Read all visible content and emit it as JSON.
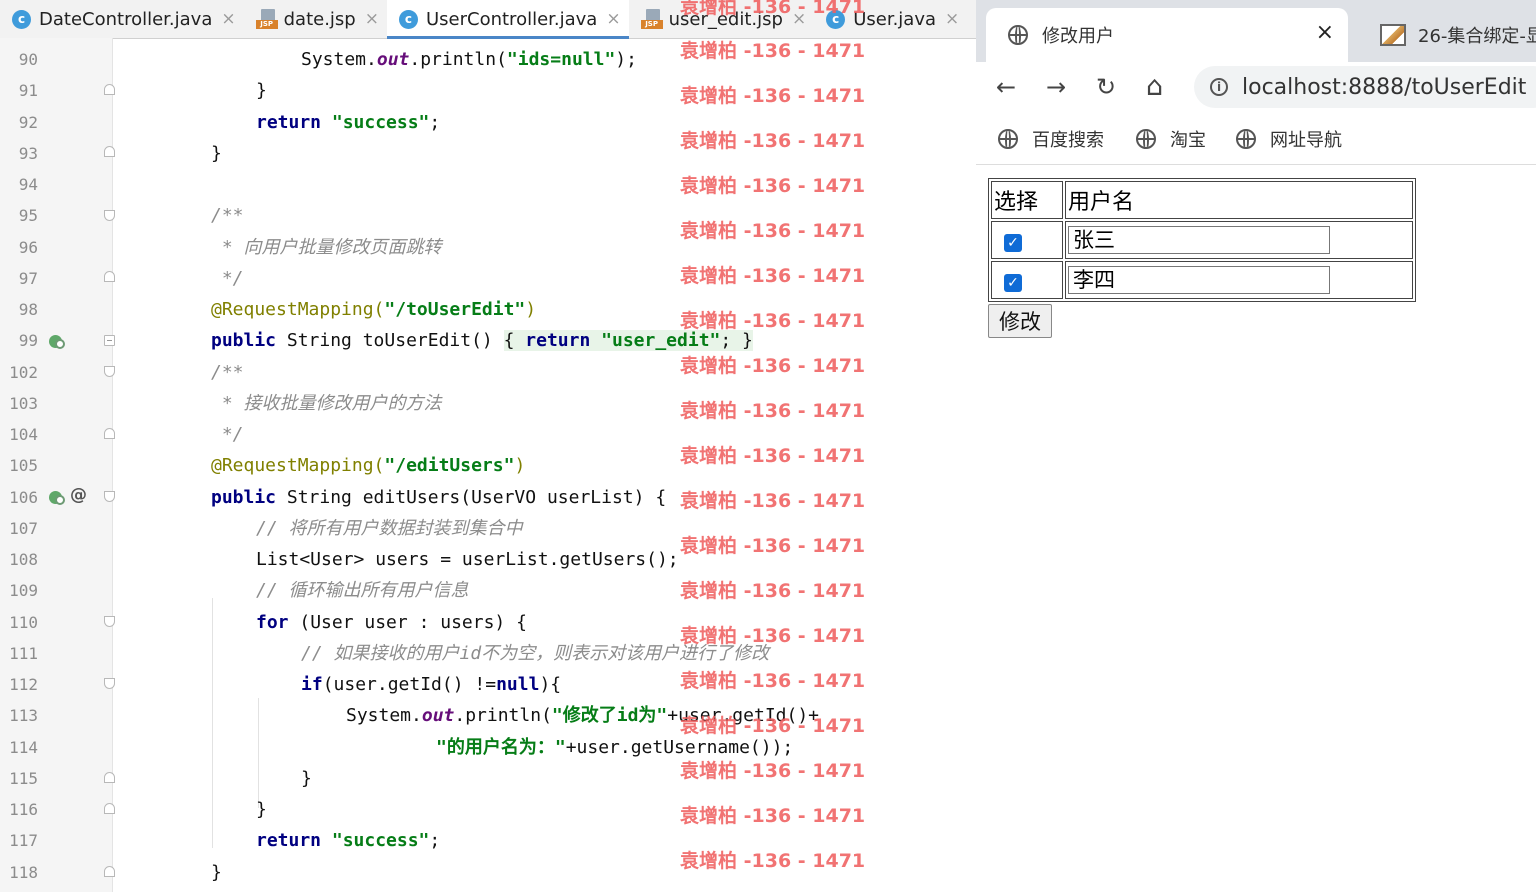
{
  "ide": {
    "tabs": [
      {
        "label": "DateController.java",
        "icon": "java-class-icon"
      },
      {
        "label": "date.jsp",
        "icon": "jsp-file-icon"
      },
      {
        "label": "UserController.java",
        "icon": "java-class-icon",
        "active": true
      },
      {
        "label": "user_edit.jsp",
        "icon": "jsp-file-icon"
      },
      {
        "label": "User.java",
        "icon": "java-class-icon"
      }
    ],
    "close_glyph": "×",
    "line_numbers": [
      "90",
      "91",
      "92",
      "93",
      "94",
      "95",
      "96",
      "97",
      "98",
      "99",
      "102",
      "103",
      "104",
      "105",
      "106",
      "107",
      "108",
      "109",
      "110",
      "111",
      "112",
      "113",
      "114",
      "115",
      "116",
      "117",
      "118"
    ],
    "code": [
      {
        "indent": 3,
        "tokens": [
          [
            "",
            "System."
          ],
          [
            "fld",
            "out"
          ],
          [
            "",
            ".println("
          ],
          [
            "str",
            "\"ids=null\""
          ],
          [
            "",
            ");"
          ]
        ]
      },
      {
        "indent": 2,
        "tokens": [
          [
            "",
            "}"
          ]
        ]
      },
      {
        "indent": 2,
        "tokens": [
          [
            "kw",
            "return "
          ],
          [
            "str",
            "\"success\""
          ],
          [
            "",
            ";"
          ]
        ]
      },
      {
        "indent": 1,
        "tokens": [
          [
            "",
            "}"
          ]
        ]
      },
      {
        "indent": 0,
        "tokens": []
      },
      {
        "indent": 1,
        "tokens": [
          [
            "cm",
            "/**"
          ]
        ]
      },
      {
        "indent": 1,
        "tokens": [
          [
            "cm",
            " * 向用户批量修改页面跳转"
          ]
        ]
      },
      {
        "indent": 1,
        "tokens": [
          [
            "cm",
            " */"
          ]
        ]
      },
      {
        "indent": 1,
        "tokens": [
          [
            "ann",
            "@RequestMapping("
          ],
          [
            "str",
            "\"/toUserEdit\""
          ],
          [
            "ann",
            ")"
          ]
        ]
      },
      {
        "indent": 1,
        "tokens": [
          [
            "kw",
            "public "
          ],
          [
            "",
            "String toUserEdit() "
          ],
          [
            "",
            "{ "
          ],
          [
            "kw",
            "return "
          ],
          [
            "str",
            "\"user_edit\""
          ],
          [
            "",
            ";"
          ],
          [
            "",
            " }"
          ]
        ],
        "hl": true
      },
      {
        "indent": 1,
        "tokens": [
          [
            "cm",
            "/**"
          ]
        ]
      },
      {
        "indent": 1,
        "tokens": [
          [
            "cm",
            " * 接收批量修改用户的方法"
          ]
        ]
      },
      {
        "indent": 1,
        "tokens": [
          [
            "cm",
            " */"
          ]
        ]
      },
      {
        "indent": 1,
        "tokens": [
          [
            "ann",
            "@RequestMapping("
          ],
          [
            "str",
            "\"/editUsers\""
          ],
          [
            "ann",
            ")"
          ]
        ]
      },
      {
        "indent": 1,
        "tokens": [
          [
            "kw",
            "public "
          ],
          [
            "",
            "String editUsers(UserVO userList) {"
          ]
        ]
      },
      {
        "indent": 2,
        "tokens": [
          [
            "cm",
            "// 将所有用户数据封装到集合中"
          ]
        ]
      },
      {
        "indent": 2,
        "tokens": [
          [
            "",
            "List<User> users = userList.getUsers();"
          ]
        ]
      },
      {
        "indent": 2,
        "tokens": [
          [
            "cm",
            "// 循环输出所有用户信息"
          ]
        ]
      },
      {
        "indent": 2,
        "tokens": [
          [
            "kw",
            "for "
          ],
          [
            "",
            "(User user : users) {"
          ]
        ]
      },
      {
        "indent": 3,
        "tokens": [
          [
            "cm",
            "// 如果接收的用户id不为空，则表示对该用户进行了修改"
          ]
        ]
      },
      {
        "indent": 3,
        "tokens": [
          [
            "kw",
            "if"
          ],
          [
            "",
            "(user.getId() !="
          ],
          [
            "kw",
            "null"
          ],
          [
            "",
            "){"
          ]
        ]
      },
      {
        "indent": 4,
        "tokens": [
          [
            "",
            "System."
          ],
          [
            "fld",
            "out"
          ],
          [
            "",
            ".println("
          ],
          [
            "str",
            "\"修改了id为\""
          ],
          [
            "",
            "+user.getId()+"
          ]
        ]
      },
      {
        "indent": 6,
        "tokens": [
          [
            "str",
            "\"的用户名为：\""
          ],
          [
            "",
            "+user.getUsername());"
          ]
        ]
      },
      {
        "indent": 3,
        "tokens": [
          [
            "",
            "}"
          ]
        ]
      },
      {
        "indent": 2,
        "tokens": [
          [
            "",
            "}"
          ]
        ]
      },
      {
        "indent": 2,
        "tokens": [
          [
            "kw",
            "return "
          ],
          [
            "str",
            "\"success\""
          ],
          [
            "",
            ";"
          ]
        ]
      },
      {
        "indent": 1,
        "tokens": [
          [
            "",
            "}"
          ]
        ]
      }
    ],
    "watermark": "袁增柏 -136 - 1471"
  },
  "browser": {
    "active_tab": {
      "title": "修改用户",
      "close": "×"
    },
    "inactive_tab": {
      "title": "26-集合绑定-显"
    },
    "nav": {
      "back": "←",
      "forward": "→",
      "reload": "↻",
      "home": "⌂"
    },
    "url": "localhost:8888/toUserEdit",
    "bookmarks": [
      "百度搜索",
      "淘宝",
      "网址导航"
    ],
    "page": {
      "headers": [
        "选择",
        "用户名"
      ],
      "rows": [
        {
          "checked": true,
          "username": "张三"
        },
        {
          "checked": true,
          "username": "李四"
        }
      ],
      "check_glyph": "✓",
      "submit_label": "修改"
    }
  }
}
